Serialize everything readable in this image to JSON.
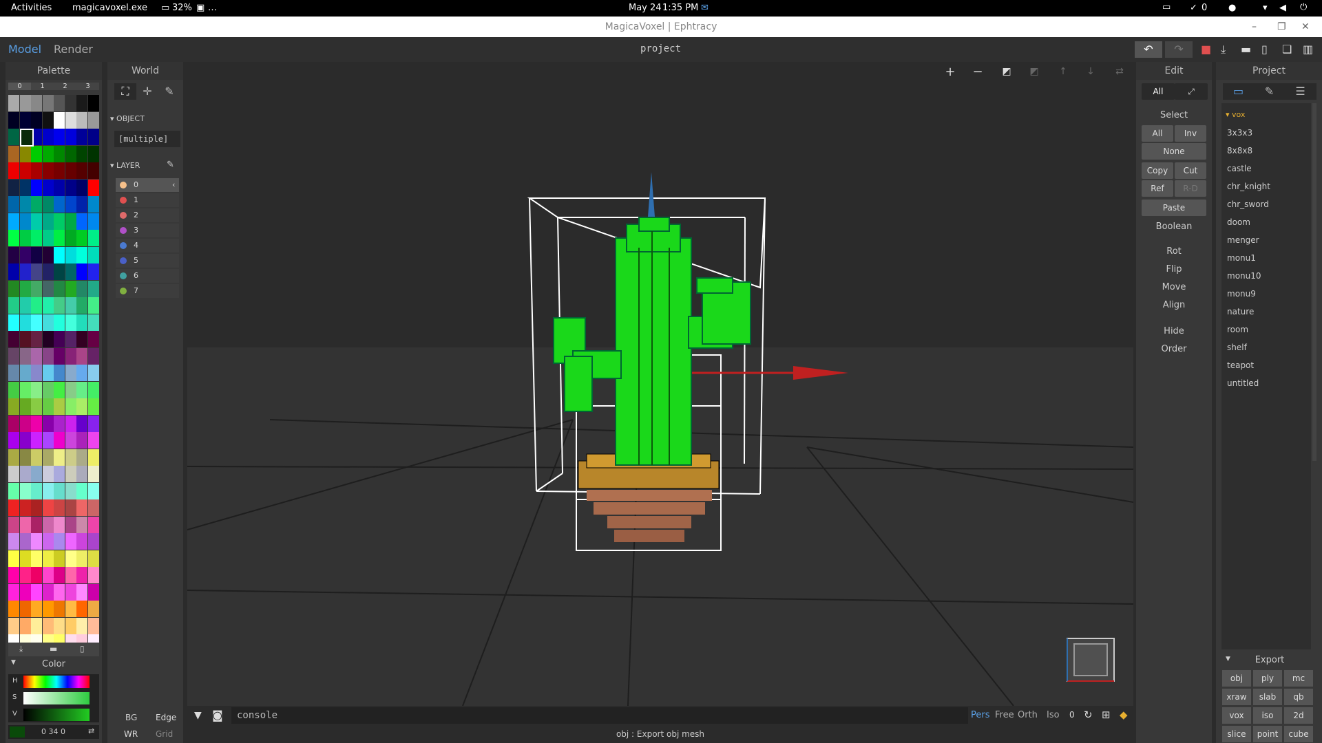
{
  "topbar": {
    "activities": "Activities",
    "app": "magicavoxel.exe",
    "battery": "32%",
    "extra": "…",
    "date": "May 24",
    "time": "1:35 PM",
    "check_count": "0"
  },
  "window": {
    "title": "MagicaVoxel | Ephtracy"
  },
  "header": {
    "tab_model": "Model",
    "tab_render": "Render",
    "project_name": "project"
  },
  "palette": {
    "title": "Palette",
    "cols": [
      "0",
      "1",
      "2",
      "3"
    ]
  },
  "world": {
    "title": "World",
    "object_label": "OBJECT",
    "object_value": "[multiple]",
    "layer_label": "LAYER",
    "layers": [
      {
        "n": "0",
        "c": "#f6c08a"
      },
      {
        "n": "1",
        "c": "#e05050"
      },
      {
        "n": "2",
        "c": "#e06a6a"
      },
      {
        "n": "3",
        "c": "#b050c8"
      },
      {
        "n": "4",
        "c": "#4a7ad0"
      },
      {
        "n": "5",
        "c": "#4a60c8"
      },
      {
        "n": "6",
        "c": "#40a0a0"
      },
      {
        "n": "7",
        "c": "#80b040"
      }
    ]
  },
  "color": {
    "title": "Color",
    "h": "H",
    "s": "S",
    "v": "V",
    "value": "0  34  0"
  },
  "bottom_left": {
    "bg": "BG",
    "edge": "Edge",
    "wr": "WR",
    "grid": "Grid"
  },
  "edit": {
    "title": "Edit",
    "all": "All",
    "select": "Select",
    "sel_all": "All",
    "inv": "Inv",
    "none": "None",
    "copy": "Copy",
    "cut": "Cut",
    "ref": "Ref",
    "rd": "R-D",
    "paste": "Paste",
    "boolean": "Boolean",
    "rot": "Rot",
    "flip": "Flip",
    "move": "Move",
    "align": "Align",
    "hide": "Hide",
    "order": "Order"
  },
  "project": {
    "title": "Project",
    "folder": "vox",
    "items": [
      "3x3x3",
      "8x8x8",
      "castle",
      "chr_knight",
      "chr_sword",
      "doom",
      "menger",
      "monu1",
      "monu10",
      "monu9",
      "nature",
      "room",
      "shelf",
      "teapot",
      "untitled"
    ]
  },
  "export": {
    "title": "Export",
    "buttons": [
      "obj",
      "ply",
      "mc",
      "xraw",
      "slab",
      "qb",
      "vox",
      "iso",
      "2d",
      "slice",
      "point",
      "cube"
    ]
  },
  "console": {
    "placeholder": "console",
    "status": "obj : Export obj mesh"
  },
  "view": {
    "pers": "Pers",
    "free": "Free",
    "orth": "Orth",
    "iso": "Iso",
    "zero": "0"
  },
  "colors": {
    "accent": "#5aa0e6",
    "green_voxel": "#1ad81a",
    "pot": "#b8862a"
  }
}
